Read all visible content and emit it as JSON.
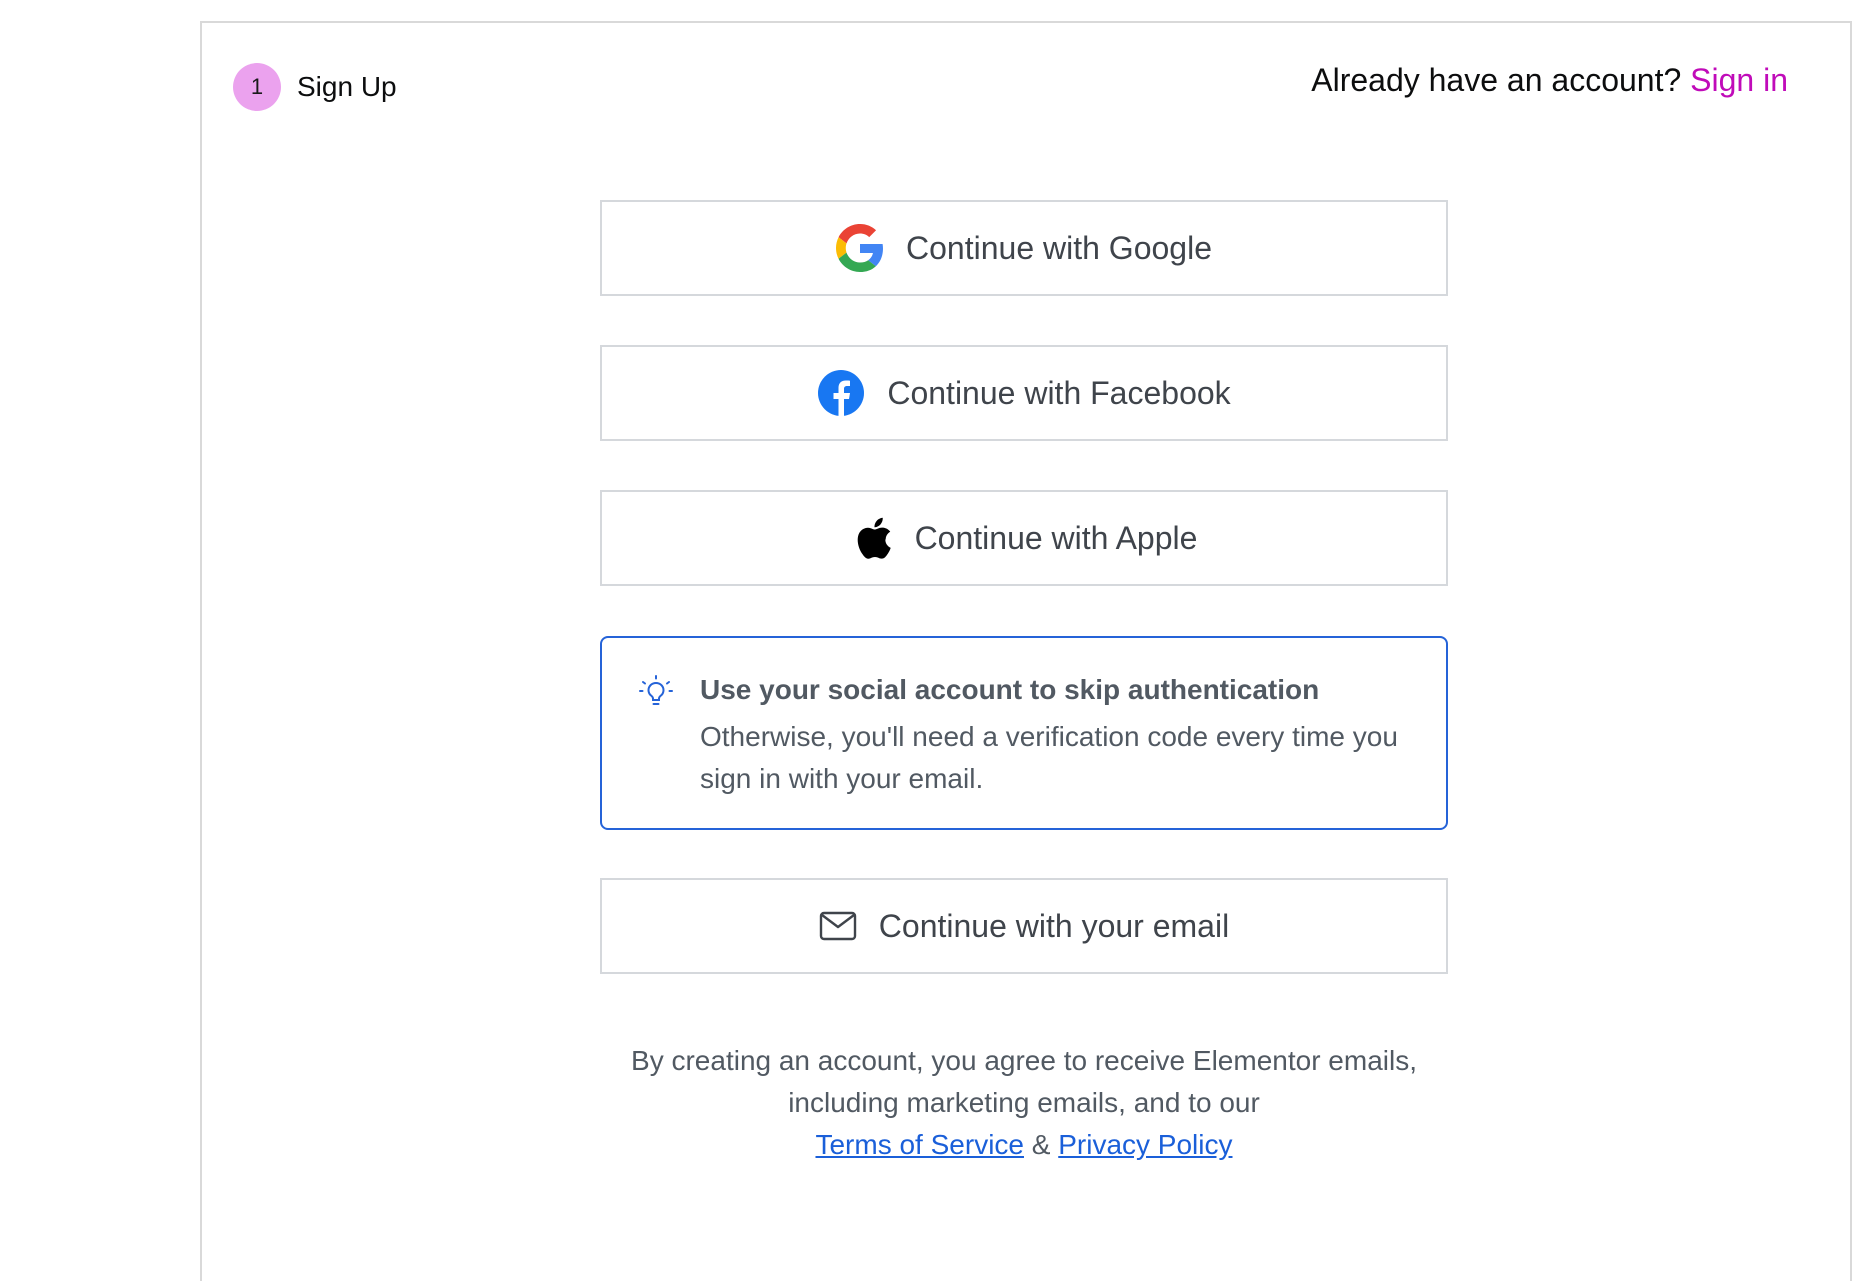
{
  "header": {
    "step_number": "1",
    "step_label": "Sign Up",
    "have_account_text": "Already have an account?",
    "signin_label": "Sign in"
  },
  "buttons": {
    "google": "Continue with Google",
    "facebook": "Continue with Facebook",
    "apple": "Continue with Apple",
    "email": "Continue with your email"
  },
  "tip": {
    "title": "Use your social account to skip authentication",
    "body": "Otherwise, you'll need a verification code every time you sign in with your email."
  },
  "legal": {
    "line1": "By creating an account, you agree to receive Elementor emails,",
    "line2": "including marketing emails, and to our",
    "terms_label": "Terms of Service",
    "and": "&",
    "privacy_label": "Privacy Policy"
  },
  "colors": {
    "accent": "#c00bb9",
    "step_badge": "#eba2ee",
    "tip_border": "#2563d8",
    "link": "#1a5fd9"
  },
  "icons": {
    "google": "google-logo-icon",
    "facebook": "facebook-logo-icon",
    "apple": "apple-logo-icon",
    "email": "envelope-icon",
    "tip": "lightbulb-icon"
  }
}
